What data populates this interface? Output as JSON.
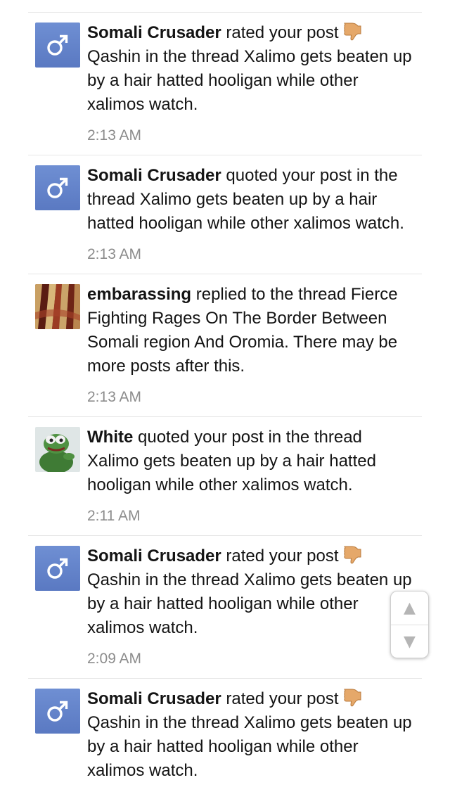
{
  "alerts": [
    {
      "avatar": "default-male",
      "user": "Somali Crusader",
      "action": " rated your post",
      "rating_icon": "thumbs-down-icon",
      "rest": "Qashin in the thread Xalimo gets beaten up by a hair hatted hooligan while other xalimos watch.",
      "time": "2:13 AM"
    },
    {
      "avatar": "default-male",
      "user": "Somali Crusader",
      "action": " quoted your post in the thread Xalimo gets beaten up by a hair hatted hooligan while other xalimos watch.",
      "rating_icon": "",
      "rest": "",
      "time": "2:13 AM"
    },
    {
      "avatar": "abstract-painting",
      "user": "embarassing",
      "action": " replied to the thread Fierce Fighting Rages On The Border Between Somali region And Oromia. There may be more posts after this.",
      "rating_icon": "",
      "rest": "",
      "time": "2:13 AM"
    },
    {
      "avatar": "green-frog",
      "user": "White",
      "action": " quoted your post in the thread Xalimo gets beaten up by a hair hatted hooligan while other xalimos watch.",
      "rating_icon": "",
      "rest": "",
      "time": "2:11 AM"
    },
    {
      "avatar": "default-male",
      "user": "Somali Crusader",
      "action": " rated your post",
      "rating_icon": "thumbs-down-icon",
      "rest": "Qashin in the thread Xalimo gets beaten up by a hair hatted hooligan while other xalimos watch.",
      "time": "2:09 AM"
    },
    {
      "avatar": "default-male",
      "user": "Somali Crusader",
      "action": " rated your post",
      "rating_icon": "thumbs-down-icon",
      "rest": "Qashin in the thread Xalimo gets beaten up by a hair hatted hooligan while other xalimos watch.",
      "time": ""
    }
  ],
  "scroll": {
    "up": "▲",
    "down": "▼"
  },
  "colors": {
    "avatar_default": "#6183c9",
    "time_text": "#8c8c8c",
    "divider": "#e6e6e6",
    "thumb": "#e5a86a"
  }
}
